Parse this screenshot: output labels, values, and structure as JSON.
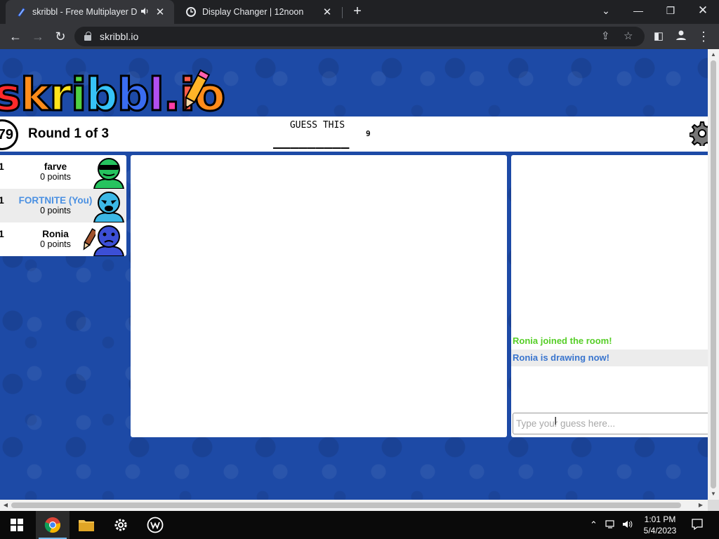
{
  "browser": {
    "tabs": [
      {
        "title": "skribbl - Free Multiplayer Dr",
        "favicon": "skribbl-pencil-icon",
        "active": true,
        "audio": true
      },
      {
        "title": "Display Changer | 12noon",
        "favicon": "12noon-clock-icon",
        "active": false
      }
    ],
    "url": "skribbl.io"
  },
  "game": {
    "logo": {
      "letters": [
        "s",
        "k",
        "r",
        "i",
        "b",
        "b",
        "l",
        ".",
        "i",
        "o",
        "!"
      ]
    },
    "timer": "79",
    "round": "Round 1 of 3",
    "guess_label": "GUESS THIS",
    "word": "_________",
    "word_length": "9",
    "players": [
      {
        "rank": "1",
        "name": "farve",
        "points": "0 points",
        "is_you": false,
        "avatar_color": "#26c35f",
        "drawing": false
      },
      {
        "rank": "1",
        "name": "FORTNITE (You)",
        "points": "0 points",
        "is_you": true,
        "avatar_color": "#3cb8e6",
        "drawing": false
      },
      {
        "rank": "1",
        "name": "Ronia",
        "points": "0 points",
        "is_you": false,
        "avatar_color": "#3c4fd6",
        "drawing": true
      }
    ],
    "chat": {
      "messages": [
        {
          "text": "Ronia joined the room!",
          "color": "#56ce27"
        },
        {
          "text": "Ronia is drawing now!",
          "color": "#3975ce"
        }
      ],
      "placeholder": "Type your guess here..."
    }
  },
  "taskbar": {
    "apps": [
      "windows-start-icon",
      "chrome-icon",
      "file-explorer-icon",
      "settings-gear-icon",
      "wacom-icon"
    ],
    "time": "1:01 PM",
    "date": "5/4/2023"
  },
  "colors": {
    "page_background": "#1d4aa6",
    "you_name": "#4a90e2",
    "join_message": "#56ce27",
    "draw_message": "#3975ce"
  }
}
